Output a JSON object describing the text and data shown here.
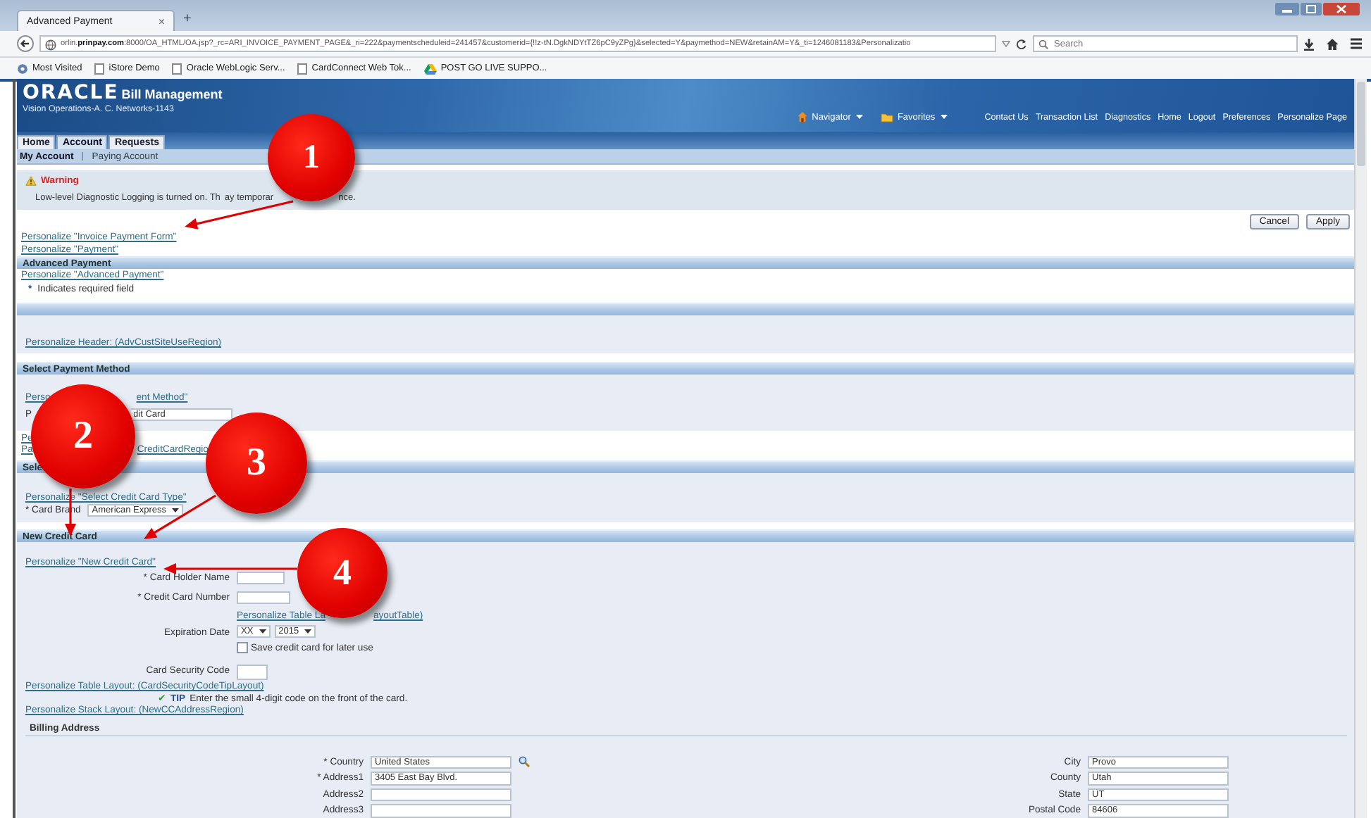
{
  "browser": {
    "tab_title": "Advanced Payment",
    "tab_close": "×",
    "new_tab": "+",
    "url": "orlin.**prinpay.com**:8000/OA_HTML/OA.jsp?_rc=ARI_INVOICE_PAYMENT_PAGE&_ri=222&paymentscheduleid=241457&customerid={!!z-tN.DgkNDYtTZ6pC9yZPg}&selected=Y&paymethod=NEW&retainAM=Y&_ti=1246081183&Personalizatio",
    "search_placeholder": "Search",
    "bookmarks": [
      {
        "label": "Most Visited",
        "kind": "gear"
      },
      {
        "label": "iStore Demo",
        "kind": "page"
      },
      {
        "label": "Oracle WebLogic Serv...",
        "kind": "page"
      },
      {
        "label": "CardConnect Web Tok...",
        "kind": "page"
      },
      {
        "label": "POST GO LIVE SUPPO...",
        "kind": "drive"
      }
    ]
  },
  "app_header": {
    "logo": "ORACLE",
    "product": "Bill Management",
    "org": "Vision Operations-A. C. Networks-1143",
    "menus": [
      {
        "label": "Navigator",
        "kind": "home"
      },
      {
        "label": "Favorites",
        "kind": "folder"
      }
    ],
    "links": [
      "Contact Us",
      "Transaction List",
      "Diagnostics",
      "Home",
      "Logout",
      "Preferences",
      "Personalize Page"
    ]
  },
  "tabs": [
    {
      "label": "Home",
      "selected": false
    },
    {
      "label": "Account",
      "selected": true
    },
    {
      "label": "Requests",
      "selected": false
    }
  ],
  "subtabs": [
    {
      "label": "My Account",
      "selected": true
    },
    {
      "label": "Paying Account",
      "selected": false
    }
  ],
  "warning": {
    "title": "Warning",
    "text_fragments": [
      "Low-level Diagnostic Logging is turned on. Th",
      "ay temporar",
      "nce."
    ]
  },
  "buttons": [
    "Cancel",
    "Apply"
  ],
  "page_links": [
    "Personalize \"Invoice Payment Form\"",
    "Personalize \"Payment\""
  ],
  "advanced_payment": {
    "title": "Advanced Payment",
    "link": "Personalize \"Advanced Payment\"",
    "required_mark": "*",
    "required_note": "Indicates required field"
  },
  "customer_region": {
    "link": "Personalize Header: (AdvCustSiteUseRegion)"
  },
  "payment_method": {
    "title": "Select Payment Method",
    "link_fragments": [
      "Perso",
      "ent Method\""
    ],
    "label_fragment": "P",
    "value": "dit Card",
    "stub_link": "Pe",
    "region_link_fragments": [
      "Pa",
      "CreditCardRegio"
    ]
  },
  "card_type": {
    "title": "Sele",
    "link": "Personalize \"Select Credit Card Type\"",
    "brand_label": "* Card Brand",
    "brand_value": "American Express"
  },
  "new_card": {
    "title": "New Credit Card",
    "link": "Personalize \"New Credit Card\"",
    "holder_label": "* Card Holder Name",
    "number_label": "* Credit Card Number",
    "expiration_label": "Expiration Date",
    "expiration_link_fragments": [
      "Personalize Table La",
      "ayoutTable)"
    ],
    "month": "XX",
    "year": "2015",
    "save": {
      "label": "Save credit card for later use",
      "checked": false
    },
    "security_label": "Card Security Code",
    "tip_layout_link": "Personalize Table Layout: (CardSecurityCodeTipLayout)",
    "tip_mark": "✔",
    "tip_label": "TIP",
    "tip_text": "Enter the small 4-digit code on the front of the card.",
    "stack_link": "Personalize Stack Layout: (NewCCAddressRegion)"
  },
  "billing": {
    "title": "Billing Address",
    "left": [
      {
        "label": "* Country",
        "value": "United States",
        "kind": "lookup"
      },
      {
        "label": "* Address1",
        "value": "3405 East Bay Blvd.",
        "kind": "text"
      },
      {
        "label": "Address2",
        "kind": "text"
      },
      {
        "label": "Address3",
        "kind": "text"
      }
    ],
    "right": [
      {
        "label": "City",
        "value": "Provo",
        "kind": "text"
      },
      {
        "label": "County",
        "value": "Utah",
        "kind": "text"
      },
      {
        "label": "State",
        "value": "UT",
        "kind": "text"
      },
      {
        "label": "Postal Code",
        "value": "84606",
        "kind": "text"
      }
    ]
  },
  "callouts": [
    "1",
    "2",
    "3",
    "4"
  ]
}
